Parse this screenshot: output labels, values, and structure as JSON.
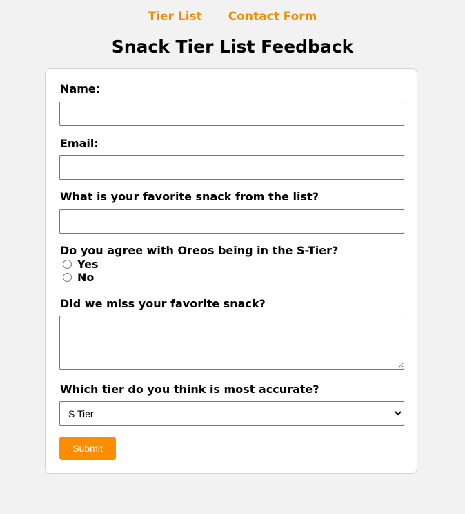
{
  "nav": {
    "items": [
      {
        "label": "Tier List"
      },
      {
        "label": "Contact Form"
      }
    ]
  },
  "page": {
    "title": "Snack Tier List Feedback"
  },
  "form": {
    "name_label": "Name:",
    "name_value": "",
    "email_label": "Email:",
    "email_value": "",
    "favorite_label": "What is your favorite snack from the list?",
    "favorite_value": "",
    "agree_label": "Do you agree with Oreos being in the S-Tier?",
    "agree_options": [
      {
        "label": "Yes",
        "checked": false
      },
      {
        "label": "No",
        "checked": false
      }
    ],
    "missed_label": "Did we miss your favorite snack?",
    "missed_value": "",
    "tier_label": "Which tier do you think is most accurate?",
    "tier_selected": "S Tier",
    "submit_label": "Submit"
  },
  "colors": {
    "accent": "#fc8c00",
    "nav_link": "#f28c00",
    "background": "#f2f2f2",
    "card": "#ffffff"
  },
  "icons": {
    "select_arrow": "chevron-down-icon"
  }
}
